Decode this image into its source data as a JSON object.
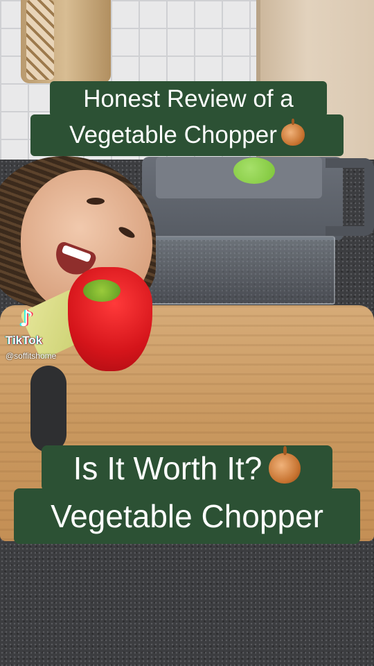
{
  "captions": {
    "top_line1": "Honest Review of a",
    "top_line2": "Vegetable Chopper",
    "bottom_line1": "Is It Worth It?",
    "bottom_line2": "Vegetable Chopper",
    "emoji_icon": "onion-emoji"
  },
  "watermark": {
    "logo_glyph": "♪",
    "brand": "TikTok",
    "handle": "@soffitshome"
  },
  "colors": {
    "caption_bg": "#2c5134",
    "caption_text": "#ffffff",
    "chopper_button": "#8fd14f",
    "pepper": "#d4141a"
  }
}
